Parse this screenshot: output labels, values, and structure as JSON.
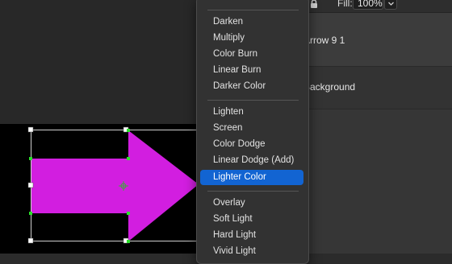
{
  "canvas": {
    "document_background": "#000000",
    "shape_fill": "#d21ee0"
  },
  "layers_panel": {
    "fill_label": "Fill:",
    "fill_value": "100%",
    "layers": [
      {
        "name": "Arrow 9 1"
      },
      {
        "name": "Background"
      }
    ]
  },
  "blend_menu": {
    "groups": [
      [
        "Darken",
        "Multiply",
        "Color Burn",
        "Linear Burn",
        "Darker Color"
      ],
      [
        "Lighten",
        "Screen",
        "Color Dodge",
        "Linear Dodge (Add)",
        "Lighter Color"
      ],
      [
        "Overlay",
        "Soft Light",
        "Hard Light",
        "Vivid Light"
      ]
    ],
    "selected": "Lighter Color",
    "selection_color": "#1264d2"
  }
}
